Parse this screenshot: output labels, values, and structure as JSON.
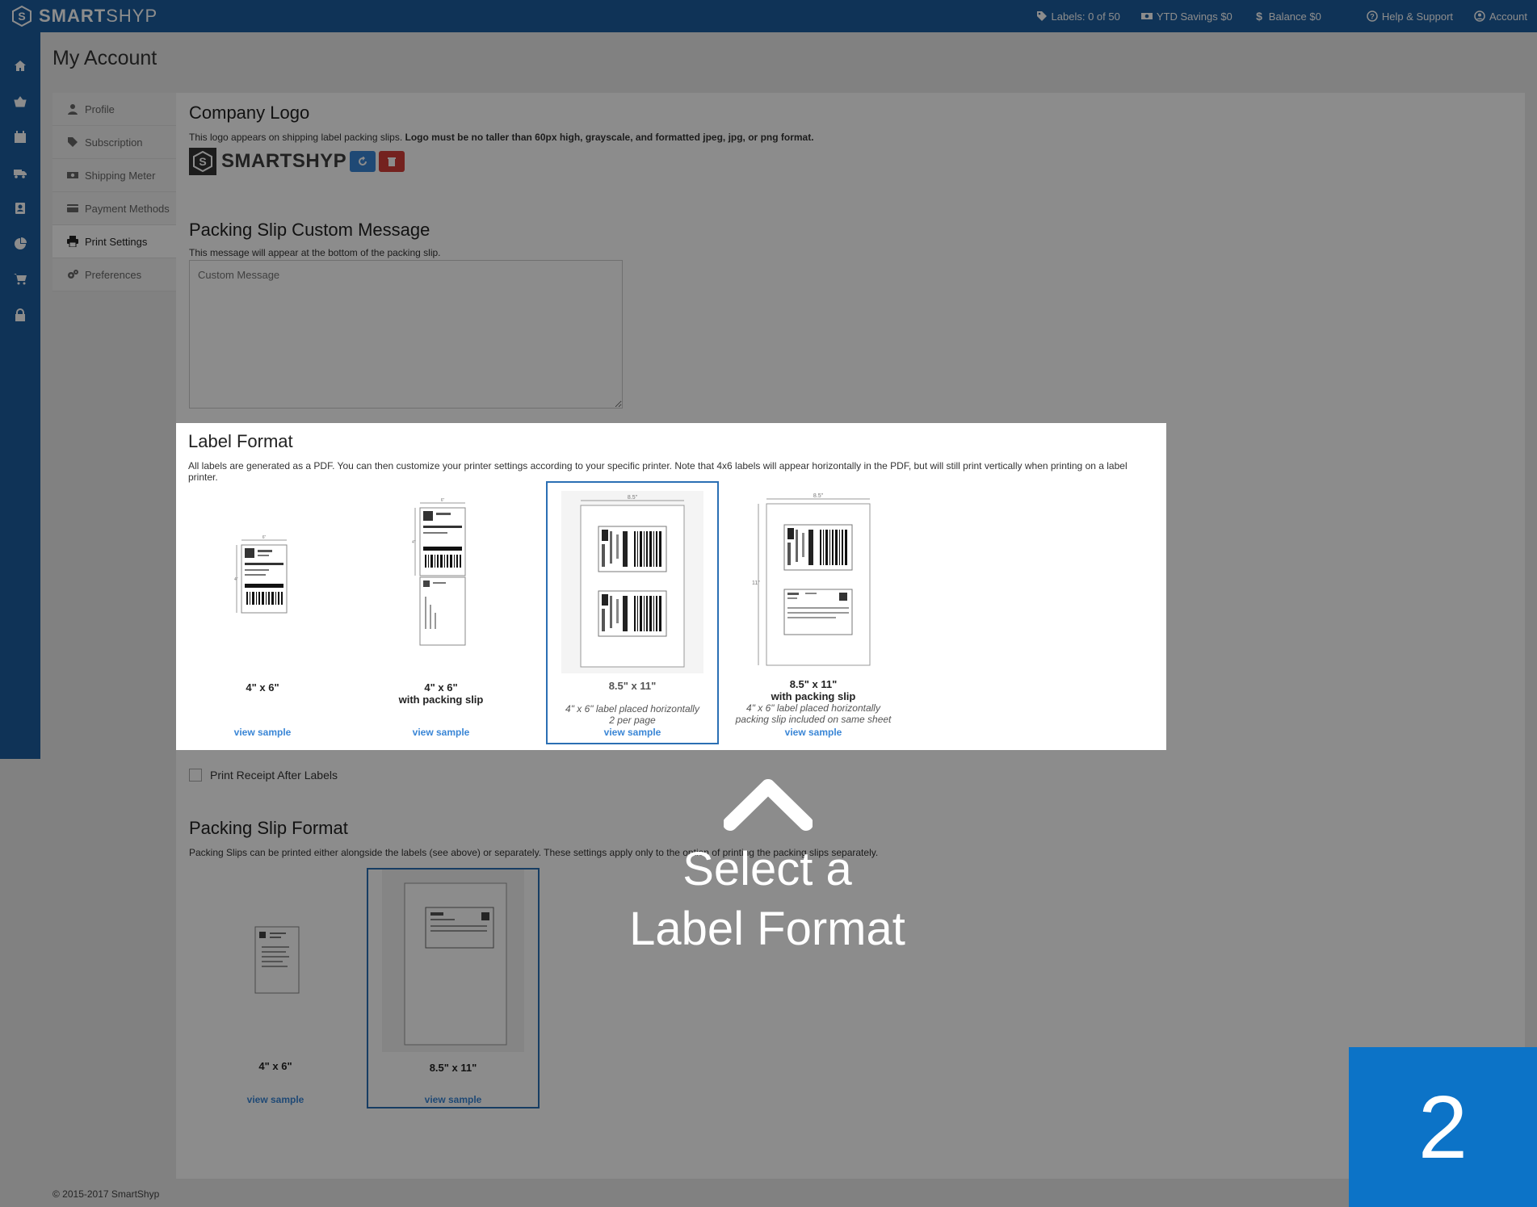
{
  "topbar": {
    "brand": "SMARTSHYP",
    "brand_bold": "SMART",
    "brand_light": "SHYP",
    "labels": "Labels: 0 of 50",
    "ytd_savings": "YTD Savings $0",
    "balance": "Balance $0",
    "help": "Help & Support",
    "account": "Account"
  },
  "sidebar": {
    "icons": [
      "home-icon",
      "basket-icon",
      "calendar-icon",
      "truck-icon",
      "contacts-icon",
      "pie-chart-icon",
      "cart-icon",
      "lock-icon"
    ]
  },
  "page": {
    "title": "My Account"
  },
  "account_nav": {
    "items": [
      {
        "label": "Profile",
        "icon": "user-icon"
      },
      {
        "label": "Subscription",
        "icon": "tag-icon"
      },
      {
        "label": "Shipping Meter",
        "icon": "money-icon"
      },
      {
        "label": "Payment Methods",
        "icon": "credit-card-icon"
      },
      {
        "label": "Print Settings",
        "icon": "print-icon",
        "active": true
      },
      {
        "label": "Preferences",
        "icon": "gears-icon"
      }
    ]
  },
  "company_logo": {
    "title": "Company Logo",
    "help_plain": "This logo appears on shipping label packing slips. ",
    "help_bold": "Logo must be no taller than 60px high, grayscale, and formatted jpeg, jpg, or png format.",
    "logo_text": "SMARTSHYP"
  },
  "packing_message": {
    "title": "Packing Slip Custom Message",
    "help": "This message will appear at the bottom of the packing slip.",
    "placeholder": "Custom Message"
  },
  "label_format": {
    "title": "Label Format",
    "help": "All labels are generated as a PDF. You can then customize your printer settings according to your specific printer. Note that 4x6 labels will appear horizontally in the PDF, but will still print vertically when printing on a label printer.",
    "options": [
      {
        "name": "4\" x 6\"",
        "sub": "",
        "desc1": "",
        "desc2": "",
        "link": "view sample"
      },
      {
        "name": "4\" x 6\"",
        "sub": "with packing slip",
        "desc1": "",
        "desc2": "",
        "link": "view sample"
      },
      {
        "name": "8.5\" x 11\"",
        "sub": "",
        "desc1": "4\" x 6\" label placed horizontally",
        "desc2": "2 per page",
        "link": "view sample",
        "selected": true
      },
      {
        "name": "8.5\" x 11\"",
        "sub": "with packing slip",
        "desc1": "4\" x 6\" label placed horizontally",
        "desc2": "packing slip included on same sheet",
        "link": "view sample"
      }
    ],
    "dims": {
      "width_small": "6\"",
      "height_small": "4\"",
      "width_large": "8.5\"",
      "height_large": "11\""
    }
  },
  "print_receipt": {
    "label": "Print Receipt After Labels"
  },
  "packing_slip_format": {
    "title": "Packing Slip Format",
    "help": "Packing Slips can be printed either alongside the labels (see above) or separately. These settings apply only to the option of printing the packing slips separately.",
    "options": [
      {
        "name": "4\" x 6\"",
        "link": "view sample"
      },
      {
        "name": "8.5\" x 11\"",
        "link": "view sample",
        "selected": true
      }
    ]
  },
  "footer": {
    "copyright": "© 2015-2017 SmartShyp"
  },
  "overlay": {
    "line1": "Select a",
    "line2": "Label Format",
    "step": "2"
  }
}
